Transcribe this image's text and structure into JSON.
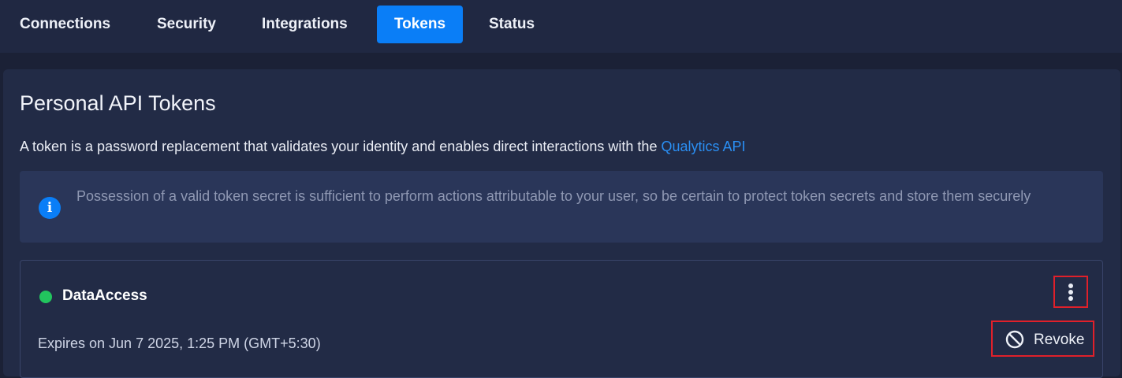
{
  "tabs": [
    {
      "label": "Connections",
      "active": false
    },
    {
      "label": "Security",
      "active": false
    },
    {
      "label": "Integrations",
      "active": false
    },
    {
      "label": "Tokens",
      "active": true
    },
    {
      "label": "Status",
      "active": false
    }
  ],
  "page": {
    "title": "Personal API Tokens",
    "description": "A token is a password replacement that validates your identity and enables direct interactions with the ",
    "api_link": "Qualytics API"
  },
  "info": {
    "icon": "info-icon",
    "text": "Possession of a valid token secret is sufficient to perform actions attributable to your user, so be certain to protect token secrets and store them securely"
  },
  "token": {
    "name": "DataAccess",
    "status": "active",
    "status_color": "#22c55e",
    "expires": "Expires on Jun 7 2025, 1:25 PM (GMT+5:30)",
    "menu_icon": "more-vertical-icon",
    "revoke_icon": "block-icon",
    "revoke_label": "Revoke"
  },
  "colors": {
    "accent": "#0a7ef7",
    "link": "#2a8ef2",
    "highlight": "#e0202a"
  }
}
